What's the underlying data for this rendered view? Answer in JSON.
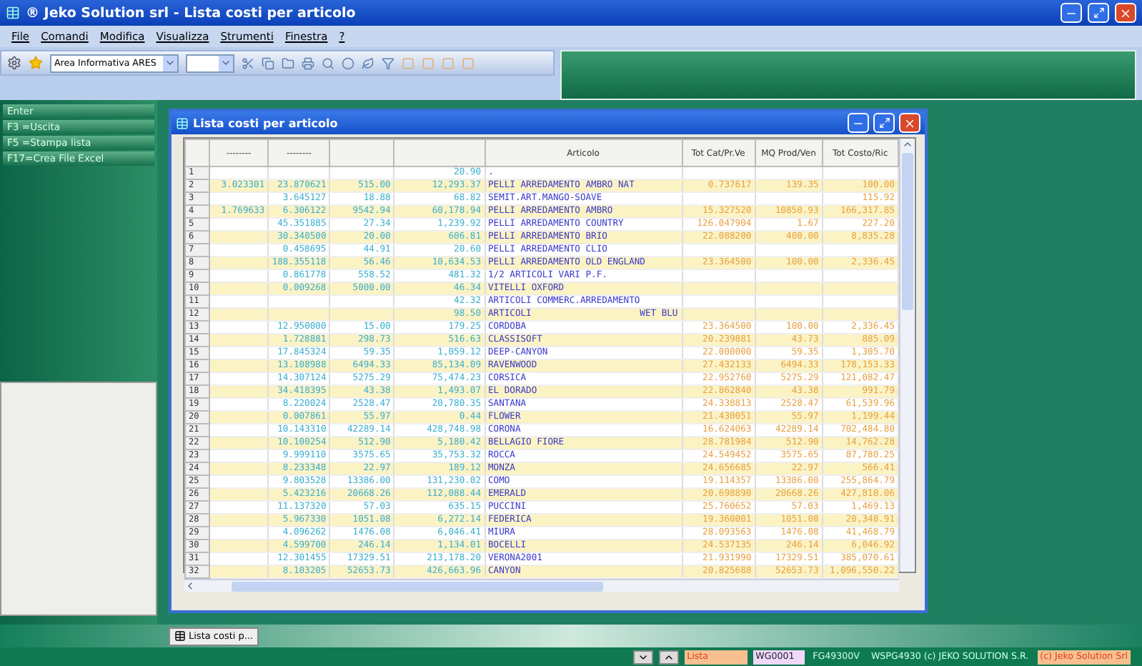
{
  "app_title": "® Jeko Solution srl - Lista costi per articolo",
  "menu": [
    "File",
    "Comandi",
    "Modifica",
    "Visualizza",
    "Strumenti",
    "Finestra",
    "?"
  ],
  "toolbar": {
    "area_combo": "Area Informativa ARES"
  },
  "sidebar": {
    "items": [
      "Enter",
      "F3 =Uscita",
      "F5 =Stampa lista",
      "F17=Crea File Excel"
    ]
  },
  "window": {
    "title": "Lista costi per articolo",
    "columns": [
      "",
      "--------",
      "--------",
      "",
      "",
      "Articolo",
      "Tot Cat/Pr.Ve",
      "MQ Prod/Ven",
      "Tot Costo/Ric"
    ],
    "rows": [
      [
        "1",
        "",
        "",
        "",
        "20.90",
        ".",
        "",
        "",
        ""
      ],
      [
        "2",
        "3.023301",
        "23.870621",
        "515.00",
        "12,293.37",
        "PELLI ARREDAMENTO AMBRO NAT",
        "0.737617",
        "139.35",
        "100.00"
      ],
      [
        "3",
        "",
        "3.645127",
        "18.88",
        "68.82",
        "SEMIT.ART.MANGO-SOAVE",
        "",
        "",
        "115.92"
      ],
      [
        "4",
        "1.769633",
        "6.306122",
        "9542.94",
        "60,178.94",
        "PELLI ARREDAMENTO AMBRO",
        "15.327520",
        "10850.93",
        "166,317.85"
      ],
      [
        "5",
        "",
        "45.351885",
        "27.34",
        "1,239.92",
        "PELLI ARREDAMENTO COUNTRY",
        "126.047904",
        "1.67",
        "227.20"
      ],
      [
        "6",
        "",
        "30.340500",
        "20.00",
        "606.81",
        "PELLI ARREDAMENTO BRIO",
        "22.088200",
        "400.00",
        "8,835.28"
      ],
      [
        "7",
        "",
        "0.458695",
        "44.91",
        "20.60",
        "PELLI ARREDAMENTO CLIO",
        "",
        "",
        ""
      ],
      [
        "8",
        "",
        "188.355118",
        "56.46",
        "10,634.53",
        "PELLI ARREDAMENTO OLD ENGLAND",
        "23.364500",
        "100.00",
        "2,336.45"
      ],
      [
        "9",
        "",
        "0.861778",
        "558.52",
        "481.32",
        "1/2 ARTICOLI VARI P.F.",
        "",
        "",
        ""
      ],
      [
        "10",
        "",
        "0.009268",
        "5000.00",
        "46.34",
        "VITELLI OXFORD",
        "",
        "",
        ""
      ],
      [
        "11",
        "",
        "",
        "",
        "42.32",
        "ARTICOLI COMMERC.ARREDAMENTO",
        "",
        "",
        ""
      ],
      [
        "12",
        "",
        "",
        "",
        "98.50",
        "ARTICOLI                    WET BLU",
        "",
        "",
        ""
      ],
      [
        "13",
        "",
        "12.950000",
        "15.00",
        "179.25",
        "CORDOBA",
        "23.364500",
        "100.00",
        "2,336.45"
      ],
      [
        "14",
        "",
        "1.728881",
        "298.73",
        "516.63",
        "CLASSISOFT",
        "20.239881",
        "43.73",
        "885.09"
      ],
      [
        "15",
        "",
        "17.845324",
        "59.35",
        "1,059.12",
        "DEEP-CANYON",
        "22.000000",
        "59.35",
        "1,305.70"
      ],
      [
        "16",
        "",
        "13.108988",
        "6494.33",
        "85,134.09",
        "RAVENWOOD",
        "27.432133",
        "6494.33",
        "178,153.33"
      ],
      [
        "17",
        "",
        "14.307124",
        "5275.29",
        "75,474.23",
        "CORSICA",
        "22.952760",
        "5275.29",
        "121,082.47"
      ],
      [
        "18",
        "",
        "34.418395",
        "43.38",
        "1,493.07",
        "EL DORADO",
        "22.862840",
        "43.38",
        "991.79"
      ],
      [
        "19",
        "",
        "8.220024",
        "2528.47",
        "20,780.35",
        "SANTANA",
        "24.338813",
        "2528.47",
        "61,539.96"
      ],
      [
        "20",
        "",
        "0.007861",
        "55.97",
        "0.44",
        "FLOWER",
        "21.430051",
        "55.97",
        "1,199.44"
      ],
      [
        "21",
        "",
        "10.143310",
        "42289.14",
        "428,748.98",
        "CORONA",
        "16.624063",
        "42289.14",
        "702,484.80"
      ],
      [
        "22",
        "",
        "10.100254",
        "512.90",
        "5,180.42",
        "BELLAGIO FIORE",
        "28.781984",
        "512.90",
        "14,762.28"
      ],
      [
        "23",
        "",
        "9.999110",
        "3575.65",
        "35,753.32",
        "ROCCA",
        "24.549452",
        "3575.65",
        "87,780.25"
      ],
      [
        "24",
        "",
        "8.233348",
        "22.97",
        "189.12",
        "MONZA",
        "24.656685",
        "22.97",
        "566.41"
      ],
      [
        "25",
        "",
        "9.803528",
        "13386.00",
        "131,230.02",
        "COMO",
        "19.114357",
        "13386.00",
        "255,864.79"
      ],
      [
        "26",
        "",
        "5.423216",
        "20668.26",
        "112,088.44",
        "EMERALD",
        "20.698890",
        "20668.26",
        "427,810.06"
      ],
      [
        "27",
        "",
        "11.137320",
        "57.03",
        "635.15",
        "PUCCINI",
        "25.760652",
        "57.03",
        "1,469.13"
      ],
      [
        "28",
        "",
        "5.967330",
        "1051.08",
        "6,272.14",
        "FEDERICA",
        "19.360001",
        "1051.08",
        "20,348.91"
      ],
      [
        "29",
        "",
        "4.096262",
        "1476.08",
        "6,046.41",
        "MIURA",
        "28.093563",
        "1476.08",
        "41,468.79"
      ],
      [
        "30",
        "",
        "4.599700",
        "246.14",
        "1,134.01",
        "BOCELLI",
        "24.537135",
        "246.14",
        "6,046.92"
      ],
      [
        "31",
        "",
        "12.301455",
        "17329.51",
        "213,178.20",
        "VERONA2001",
        "21.931990",
        "17329.51",
        "385,070.61"
      ],
      [
        "32",
        "",
        "8.103205",
        "52653.73",
        "426,663.96",
        "CANYON",
        "20.825688",
        "52653.73",
        "1,096,550.22"
      ]
    ]
  },
  "taskbar": {
    "tab": "Lista costi p..."
  },
  "status_bar": {
    "field": "Lista",
    "user": "WG0001",
    "program": "FG49300V",
    "copyright": "WSPG4930 (c) JEKO SOLUTION S.R.",
    "brand": "(c) Jeko Solution Srl"
  }
}
